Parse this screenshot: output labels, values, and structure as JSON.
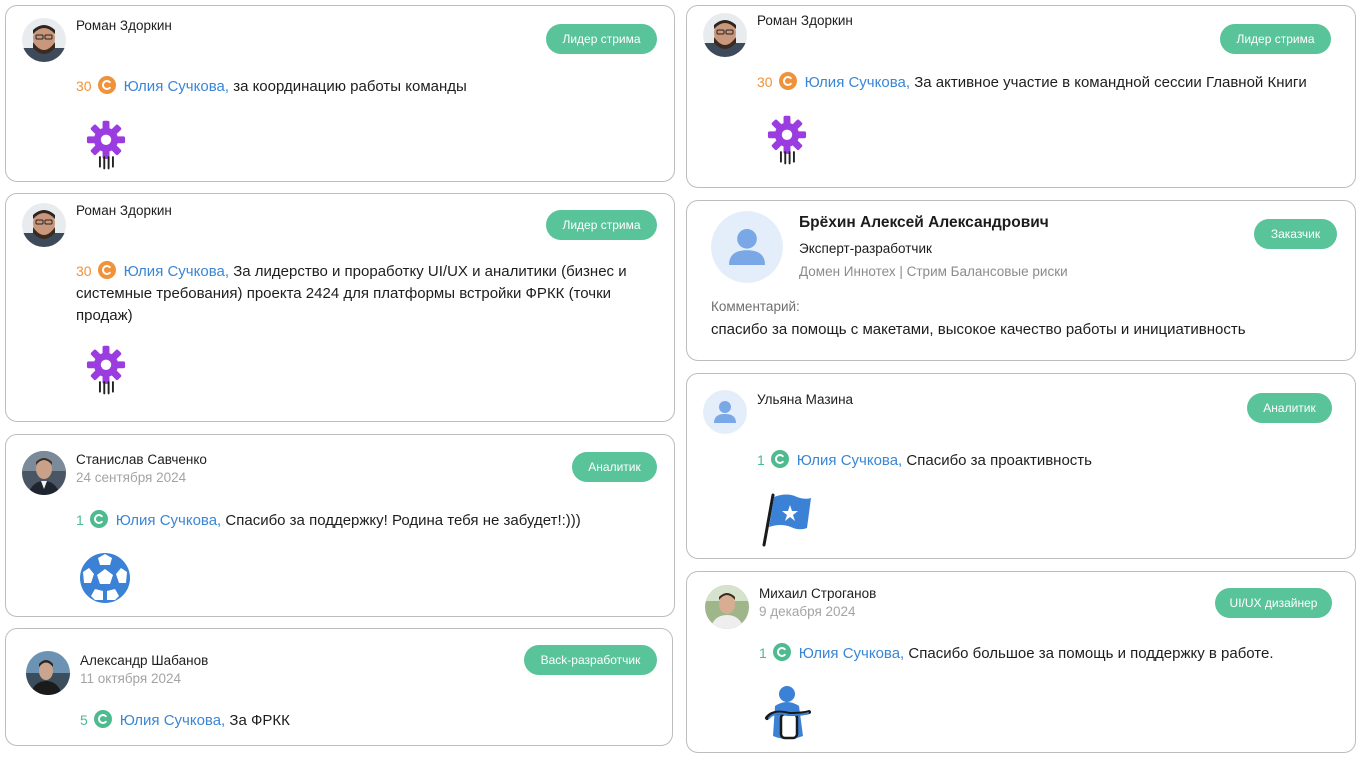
{
  "feed": [
    {
      "author": "Роман Здоркин",
      "badge": "Лидер стрима",
      "amount": "30",
      "recipient": "Юлия Сучкова,",
      "text": "за координацию работы команды",
      "award_icon": "gear-rocket-icon"
    },
    {
      "author": "Роман Здоркин",
      "badge": "Лидер стрима",
      "amount": "30",
      "recipient": "Юлия Сучкова,",
      "text": "За лидерство и проработку UI/UX и аналитики (бизнес и системные требования) проекта 2424 для платформы встройки ФРКК (точки продаж)",
      "award_icon": "gear-rocket-icon"
    },
    {
      "author": "Станислав Савченко",
      "date": "24 сентября 2024",
      "badge": "Аналитик",
      "amount": "1",
      "recipient": "Юлия Сучкова,",
      "text": "Спасибо за поддержку! Родина тебя не забудет!:)))",
      "award_icon": "soccer-ball-icon"
    },
    {
      "author": "Александр Шабанов",
      "date": "11 октября 2024",
      "badge": "Back-разработчик",
      "amount": "5",
      "recipient": "Юлия Сучкова,",
      "text": "За ФРКК"
    },
    {
      "author": "Роман Здоркин",
      "badge": "Лидер стрима",
      "amount": "30",
      "recipient": "Юлия Сучкова,",
      "text": "За активное участие в командной сессии Главной Книги",
      "award_icon": "gear-rocket-icon"
    },
    {
      "author": "Брёхин Алексей Александрович",
      "role": "Эксперт-разработчик",
      "domain": "Домен Иннотех | Стрим Балансовые риски",
      "badge": "Заказчик",
      "comment_label": "Комментарий:",
      "comment": "спасибо за помощь с макетами, высокое качество работы и инициативность"
    },
    {
      "author": "Ульяна Мазина",
      "badge": "Аналитик",
      "amount": "1",
      "recipient": "Юлия Сучкова,",
      "text": "Спасибо за проактивность",
      "award_icon": "flag-star-icon"
    },
    {
      "author": "Михаил Строганов",
      "date": "9 декабря 2024",
      "badge": "UI/UX дизайнер",
      "amount": "1",
      "recipient": "Юлия Сучкова,",
      "text": "Спасибо большое за помощь и поддержку в работе.",
      "award_icon": "hug-icon"
    }
  ],
  "colors": {
    "badge": "#59c39a",
    "recipient_link": "#3a86d6",
    "coin_orange": "#f0923a",
    "coin_green": "#4dbb8f",
    "award_purple": "#9b3ce0",
    "award_blue": "#3b82d6"
  }
}
